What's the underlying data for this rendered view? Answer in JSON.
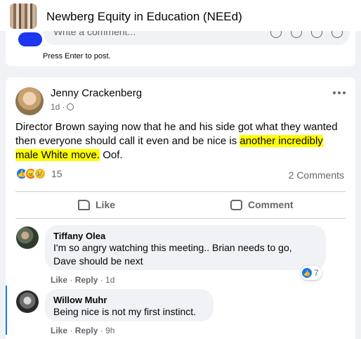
{
  "group": {
    "title": "Newberg Equity in Education (NEEd)"
  },
  "composer": {
    "placeholder": "Write a comment...",
    "hint": "Press Enter to post."
  },
  "post": {
    "author": "Jenny Crackenberg",
    "time": "1d",
    "text_before": "Director Brown saying now that he and his side got what they wanted then everyone should call it even and be nice is ",
    "text_highlight": "another incredibly male White move.",
    "text_after": " Oof.",
    "reaction_count": "15",
    "comments_count": "2 Comments",
    "like_label": "Like",
    "comment_label": "Comment"
  },
  "comments": [
    {
      "author": "Tiffany Olea",
      "text": "I'm so angry watching this meeting.. Brian needs to go, Dave should be next",
      "like": "Like",
      "reply": "Reply",
      "time": "1d",
      "reactions": "7"
    },
    {
      "author": "Willow Muhr",
      "text": "Being nice is not my first instinct.",
      "like": "Like",
      "reply": "Reply",
      "time": "9h"
    }
  ],
  "colors": {
    "accent": "#1877f2",
    "highlight": "#ffff00",
    "background": "#f0f2f5"
  },
  "icons": {
    "more": "more-options-icon",
    "globe": "globe-icon",
    "like": "thumbs-up-icon",
    "comment": "comment-icon"
  }
}
